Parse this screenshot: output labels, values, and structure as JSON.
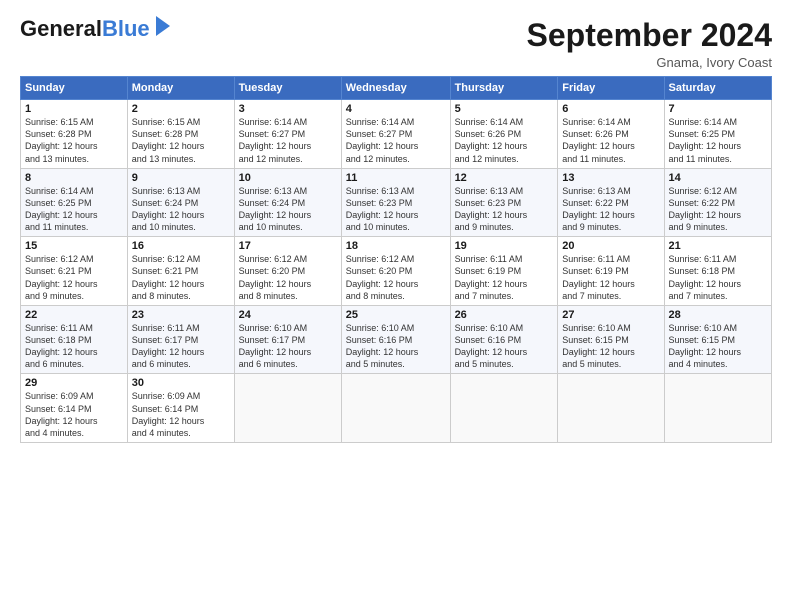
{
  "header": {
    "logo_general": "General",
    "logo_blue": "Blue",
    "month_title": "September 2024",
    "location": "Gnama, Ivory Coast"
  },
  "days_of_week": [
    "Sunday",
    "Monday",
    "Tuesday",
    "Wednesday",
    "Thursday",
    "Friday",
    "Saturday"
  ],
  "weeks": [
    [
      {
        "day": "1",
        "info": "Sunrise: 6:15 AM\nSunset: 6:28 PM\nDaylight: 12 hours\nand 13 minutes."
      },
      {
        "day": "2",
        "info": "Sunrise: 6:15 AM\nSunset: 6:28 PM\nDaylight: 12 hours\nand 13 minutes."
      },
      {
        "day": "3",
        "info": "Sunrise: 6:14 AM\nSunset: 6:27 PM\nDaylight: 12 hours\nand 12 minutes."
      },
      {
        "day": "4",
        "info": "Sunrise: 6:14 AM\nSunset: 6:27 PM\nDaylight: 12 hours\nand 12 minutes."
      },
      {
        "day": "5",
        "info": "Sunrise: 6:14 AM\nSunset: 6:26 PM\nDaylight: 12 hours\nand 12 minutes."
      },
      {
        "day": "6",
        "info": "Sunrise: 6:14 AM\nSunset: 6:26 PM\nDaylight: 12 hours\nand 11 minutes."
      },
      {
        "day": "7",
        "info": "Sunrise: 6:14 AM\nSunset: 6:25 PM\nDaylight: 12 hours\nand 11 minutes."
      }
    ],
    [
      {
        "day": "8",
        "info": "Sunrise: 6:14 AM\nSunset: 6:25 PM\nDaylight: 12 hours\nand 11 minutes."
      },
      {
        "day": "9",
        "info": "Sunrise: 6:13 AM\nSunset: 6:24 PM\nDaylight: 12 hours\nand 10 minutes."
      },
      {
        "day": "10",
        "info": "Sunrise: 6:13 AM\nSunset: 6:24 PM\nDaylight: 12 hours\nand 10 minutes."
      },
      {
        "day": "11",
        "info": "Sunrise: 6:13 AM\nSunset: 6:23 PM\nDaylight: 12 hours\nand 10 minutes."
      },
      {
        "day": "12",
        "info": "Sunrise: 6:13 AM\nSunset: 6:23 PM\nDaylight: 12 hours\nand 9 minutes."
      },
      {
        "day": "13",
        "info": "Sunrise: 6:13 AM\nSunset: 6:22 PM\nDaylight: 12 hours\nand 9 minutes."
      },
      {
        "day": "14",
        "info": "Sunrise: 6:12 AM\nSunset: 6:22 PM\nDaylight: 12 hours\nand 9 minutes."
      }
    ],
    [
      {
        "day": "15",
        "info": "Sunrise: 6:12 AM\nSunset: 6:21 PM\nDaylight: 12 hours\nand 9 minutes."
      },
      {
        "day": "16",
        "info": "Sunrise: 6:12 AM\nSunset: 6:21 PM\nDaylight: 12 hours\nand 8 minutes."
      },
      {
        "day": "17",
        "info": "Sunrise: 6:12 AM\nSunset: 6:20 PM\nDaylight: 12 hours\nand 8 minutes."
      },
      {
        "day": "18",
        "info": "Sunrise: 6:12 AM\nSunset: 6:20 PM\nDaylight: 12 hours\nand 8 minutes."
      },
      {
        "day": "19",
        "info": "Sunrise: 6:11 AM\nSunset: 6:19 PM\nDaylight: 12 hours\nand 7 minutes."
      },
      {
        "day": "20",
        "info": "Sunrise: 6:11 AM\nSunset: 6:19 PM\nDaylight: 12 hours\nand 7 minutes."
      },
      {
        "day": "21",
        "info": "Sunrise: 6:11 AM\nSunset: 6:18 PM\nDaylight: 12 hours\nand 7 minutes."
      }
    ],
    [
      {
        "day": "22",
        "info": "Sunrise: 6:11 AM\nSunset: 6:18 PM\nDaylight: 12 hours\nand 6 minutes."
      },
      {
        "day": "23",
        "info": "Sunrise: 6:11 AM\nSunset: 6:17 PM\nDaylight: 12 hours\nand 6 minutes."
      },
      {
        "day": "24",
        "info": "Sunrise: 6:10 AM\nSunset: 6:17 PM\nDaylight: 12 hours\nand 6 minutes."
      },
      {
        "day": "25",
        "info": "Sunrise: 6:10 AM\nSunset: 6:16 PM\nDaylight: 12 hours\nand 5 minutes."
      },
      {
        "day": "26",
        "info": "Sunrise: 6:10 AM\nSunset: 6:16 PM\nDaylight: 12 hours\nand 5 minutes."
      },
      {
        "day": "27",
        "info": "Sunrise: 6:10 AM\nSunset: 6:15 PM\nDaylight: 12 hours\nand 5 minutes."
      },
      {
        "day": "28",
        "info": "Sunrise: 6:10 AM\nSunset: 6:15 PM\nDaylight: 12 hours\nand 4 minutes."
      }
    ],
    [
      {
        "day": "29",
        "info": "Sunrise: 6:09 AM\nSunset: 6:14 PM\nDaylight: 12 hours\nand 4 minutes."
      },
      {
        "day": "30",
        "info": "Sunrise: 6:09 AM\nSunset: 6:14 PM\nDaylight: 12 hours\nand 4 minutes."
      },
      {
        "day": "",
        "info": ""
      },
      {
        "day": "",
        "info": ""
      },
      {
        "day": "",
        "info": ""
      },
      {
        "day": "",
        "info": ""
      },
      {
        "day": "",
        "info": ""
      }
    ]
  ]
}
